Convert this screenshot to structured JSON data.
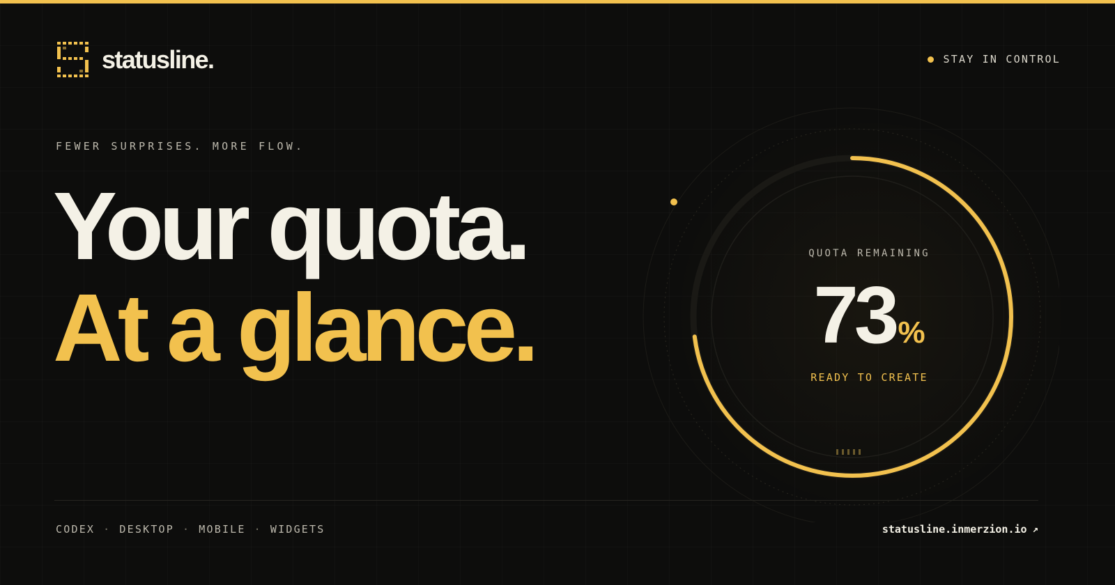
{
  "brand": {
    "name": "statusline.",
    "logo_icon": "grid-s-logo-icon",
    "accent": "#f2c14e"
  },
  "top_right": {
    "label": "STAY IN CONTROL",
    "dot_icon": "status-dot-icon"
  },
  "hero": {
    "eyebrow": "FEWER SURPRISES. MORE FLOW.",
    "line1": "Your quota.",
    "line2": "At a glance."
  },
  "gauge": {
    "label": "QUOTA REMAINING",
    "value": "73",
    "unit": "%",
    "percent": 73,
    "status": "READY TO CREATE"
  },
  "footer": {
    "platforms": [
      "CODEX",
      "DESKTOP",
      "MOBILE",
      "WIDGETS"
    ],
    "separator": "·",
    "site": "statusline.inmerzion.io",
    "site_icon": "external-arrow-icon",
    "site_arrow": "↗"
  },
  "colors": {
    "background": "#0d0d0c",
    "text": "#f4f1e6",
    "accent": "#f2c14e",
    "muted": "#bdb9ad"
  }
}
